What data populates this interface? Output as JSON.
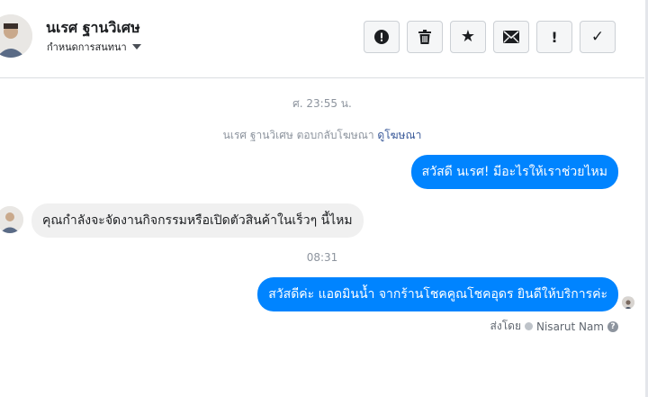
{
  "header": {
    "name": "นเรศ ฐานวิเศษ",
    "assign_label": "กำหนดการสนทนา",
    "actions": [
      {
        "icon": "alert-circle-icon",
        "glyph": ""
      },
      {
        "icon": "trash-icon",
        "glyph": ""
      },
      {
        "icon": "star-icon",
        "glyph": "★"
      },
      {
        "icon": "envelope-icon",
        "glyph": ""
      },
      {
        "icon": "exclamation-icon",
        "glyph": "!"
      },
      {
        "icon": "checkmark-icon",
        "glyph": "✓"
      }
    ]
  },
  "conversation": {
    "timestamp_1": "ศ. 23:55 น.",
    "system_text": "นเรศ ฐานวิเศษ ตอบกลับโฆษณา",
    "system_link": "ดูโฆษณา",
    "messages": [
      {
        "direction": "out",
        "text": "สวัสดี นเรศ! มีอะไรให้เราช่วยไหม"
      },
      {
        "direction": "in",
        "text": "คุณกำลังจะจัดงานกิจกรรมหรือเปิดตัวสินค้าในเร็วๆ นี้ไหม"
      },
      {
        "direction": "out",
        "text": "สวัสดีค่ะ แอดมินน้ำ จากร้านโชคคูณโชคอุดร ยินดีให้บริการค่ะ"
      }
    ],
    "timestamp_2": "08:31",
    "sent_by_label": "ส่งโดย",
    "sent_by_name": "Nisarut Nam"
  },
  "colors": {
    "outgoing": "#0084ff",
    "incoming": "#f0f0f0",
    "link": "#385898"
  }
}
